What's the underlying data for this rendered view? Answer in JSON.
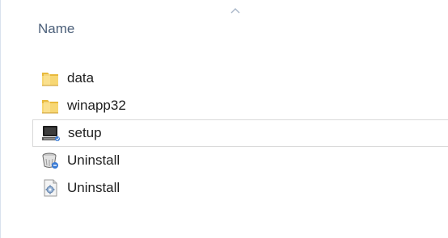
{
  "header": {
    "name_column_label": "Name",
    "sort_direction": "ascending"
  },
  "files": [
    {
      "label": "data",
      "icon": "folder-icon",
      "selected": false
    },
    {
      "label": "winapp32",
      "icon": "folder-icon",
      "selected": false
    },
    {
      "label": "setup",
      "icon": "application-icon",
      "selected": true
    },
    {
      "label": "Uninstall",
      "icon": "uninstaller-icon",
      "selected": false
    },
    {
      "label": "Uninstall",
      "icon": "settings-file-icon",
      "selected": false
    }
  ],
  "colors": {
    "header_text": "#4c607a",
    "folder_yellow": "#f2c94c",
    "selection_border": "#d9d9d9"
  }
}
